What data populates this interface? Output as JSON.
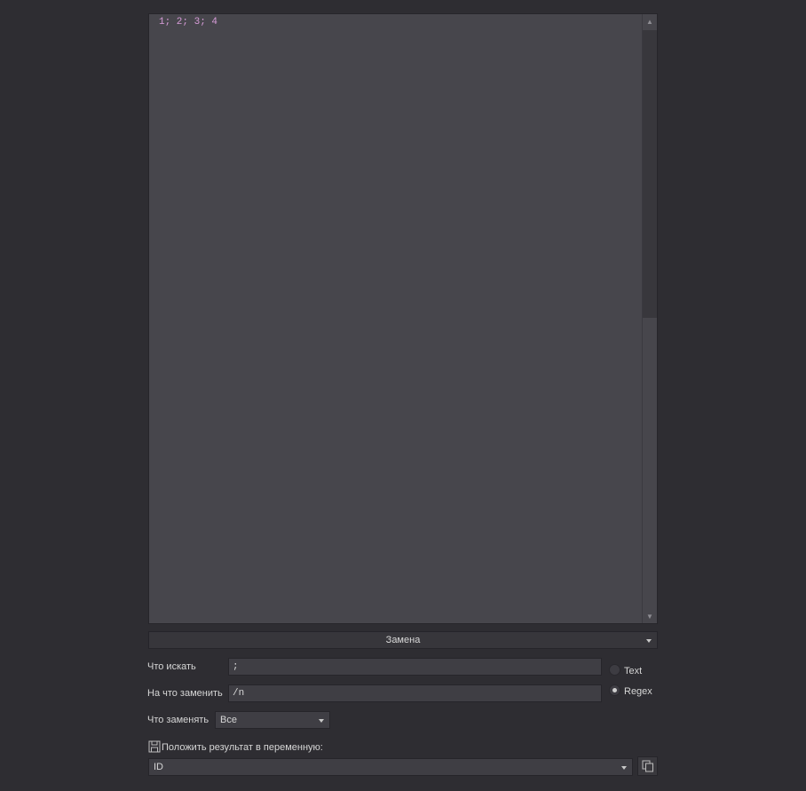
{
  "editor": {
    "content": "1; 2; 3; 4"
  },
  "mode_dropdown": {
    "selected": "Замена"
  },
  "find": {
    "label": "Что искать",
    "value": ";"
  },
  "replace": {
    "label": "На что заменить",
    "value": "/n"
  },
  "match_type": {
    "options": [
      "Text",
      "Regex"
    ],
    "selected": "Regex"
  },
  "replace_scope": {
    "label": "Что заменять",
    "selected": "Все"
  },
  "result_variable": {
    "label": "Положить результат в переменную:",
    "selected": "ID"
  },
  "icons": {
    "save": "save-icon",
    "copy": "copy-icon",
    "scroll_up": "arrow-up-icon",
    "scroll_down": "arrow-down-icon"
  },
  "colors": {
    "background": "#2e2d32",
    "editor_background": "#47464c",
    "editor_text": "#d79cd8",
    "input_background": "#3f3e44"
  }
}
